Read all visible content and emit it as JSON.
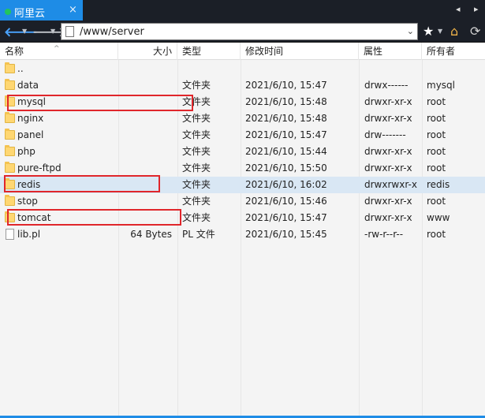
{
  "tab": {
    "title": "阿里云",
    "close": "×"
  },
  "tabnav": {
    "prev": "◂",
    "next": "▸"
  },
  "toolbar": {
    "path": "/www/server"
  },
  "columns": {
    "name": "名称",
    "size": "大小",
    "type": "类型",
    "modified": "修改时间",
    "attrs": "属性",
    "owner": "所有者"
  },
  "rows": [
    {
      "name": "..",
      "size": "",
      "type": "",
      "modified": "",
      "attrs": "",
      "owner": "",
      "icon": "folder"
    },
    {
      "name": "data",
      "size": "",
      "type": "文件夹",
      "modified": "2021/6/10, 15:47",
      "attrs": "drwx------",
      "owner": "mysql",
      "icon": "folder"
    },
    {
      "name": "mysql",
      "size": "",
      "type": "文件夹",
      "modified": "2021/6/10, 15:48",
      "attrs": "drwxr-xr-x",
      "owner": "root",
      "icon": "folder"
    },
    {
      "name": "nginx",
      "size": "",
      "type": "文件夹",
      "modified": "2021/6/10, 15:48",
      "attrs": "drwxr-xr-x",
      "owner": "root",
      "icon": "folder"
    },
    {
      "name": "panel",
      "size": "",
      "type": "文件夹",
      "modified": "2021/6/10, 15:47",
      "attrs": "drw-------",
      "owner": "root",
      "icon": "folder"
    },
    {
      "name": "php",
      "size": "",
      "type": "文件夹",
      "modified": "2021/6/10, 15:44",
      "attrs": "drwxr-xr-x",
      "owner": "root",
      "icon": "folder"
    },
    {
      "name": "pure-ftpd",
      "size": "",
      "type": "文件夹",
      "modified": "2021/6/10, 15:50",
      "attrs": "drwxr-xr-x",
      "owner": "root",
      "icon": "folder"
    },
    {
      "name": "redis",
      "size": "",
      "type": "文件夹",
      "modified": "2021/6/10, 16:02",
      "attrs": "drwxrwxr-x",
      "owner": "redis",
      "icon": "folder"
    },
    {
      "name": "stop",
      "size": "",
      "type": "文件夹",
      "modified": "2021/6/10, 15:46",
      "attrs": "drwxr-xr-x",
      "owner": "root",
      "icon": "folder"
    },
    {
      "name": "tomcat",
      "size": "",
      "type": "文件夹",
      "modified": "2021/6/10, 15:47",
      "attrs": "drwxr-xr-x",
      "owner": "www",
      "icon": "folder"
    },
    {
      "name": "lib.pl",
      "size": "64 Bytes",
      "type": "PL 文件",
      "modified": "2021/6/10, 15:45",
      "attrs": "-rw-r--r--",
      "owner": "root",
      "icon": "file"
    }
  ],
  "selected_row": "redis",
  "highlighted_rows": [
    "mysql",
    "redis",
    "tomcat"
  ],
  "colors": {
    "tab_active": "#1e8ce6",
    "toolbar_bg": "#1b1f27",
    "selected_row": "#d9e7f4",
    "highlight_border": "#e0262b",
    "folder": "#ffd772"
  }
}
